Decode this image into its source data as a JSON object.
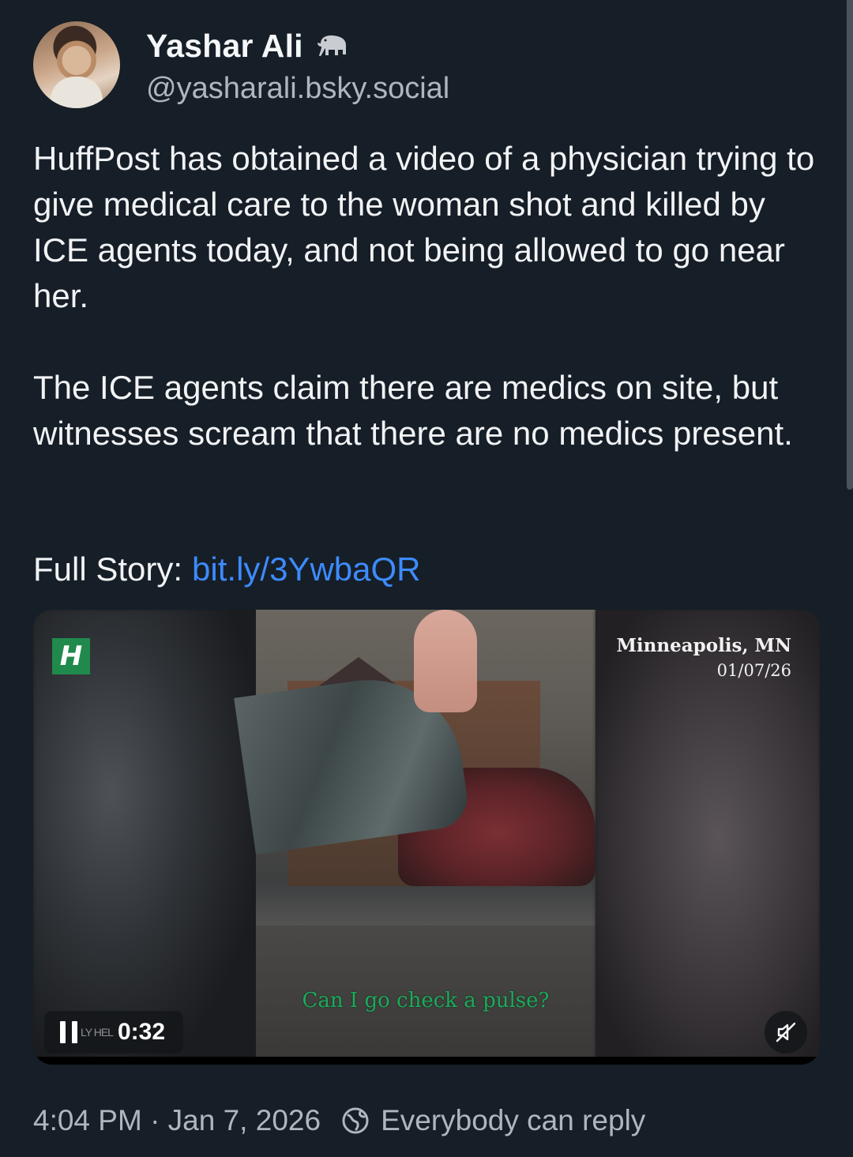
{
  "author": {
    "name": "Yashar Ali",
    "badge_icon": "elephant-icon",
    "handle": "@yasharali.bsky.social"
  },
  "post": {
    "paragraph1": "HuffPost has obtained a video of a physician trying to give medical care to the woman shot and killed by ICE agents today, and not being allowed to go near her.",
    "paragraph2": "The ICE agents claim there are medics on site, but witnesses scream that there are no medics present.",
    "story_label": "Full Story:",
    "story_link": "bit.ly/3YwbaQR"
  },
  "video": {
    "logo_text": "H",
    "location": "Minneapolis, MN",
    "date": "01/07/26",
    "caption": "Can I go check a pulse?",
    "ghost_text": "LY HEL",
    "timecode": "0:32",
    "paused": false,
    "muted": true,
    "progress": 0.0
  },
  "footer": {
    "timestamp": "4:04 PM · Jan 7, 2026",
    "reply_setting": "Everybody can reply"
  },
  "colors": {
    "background": "#161e27",
    "link": "#3d8bfd",
    "secondary_text": "#aeb6c0",
    "caption": "#1fa85c"
  }
}
